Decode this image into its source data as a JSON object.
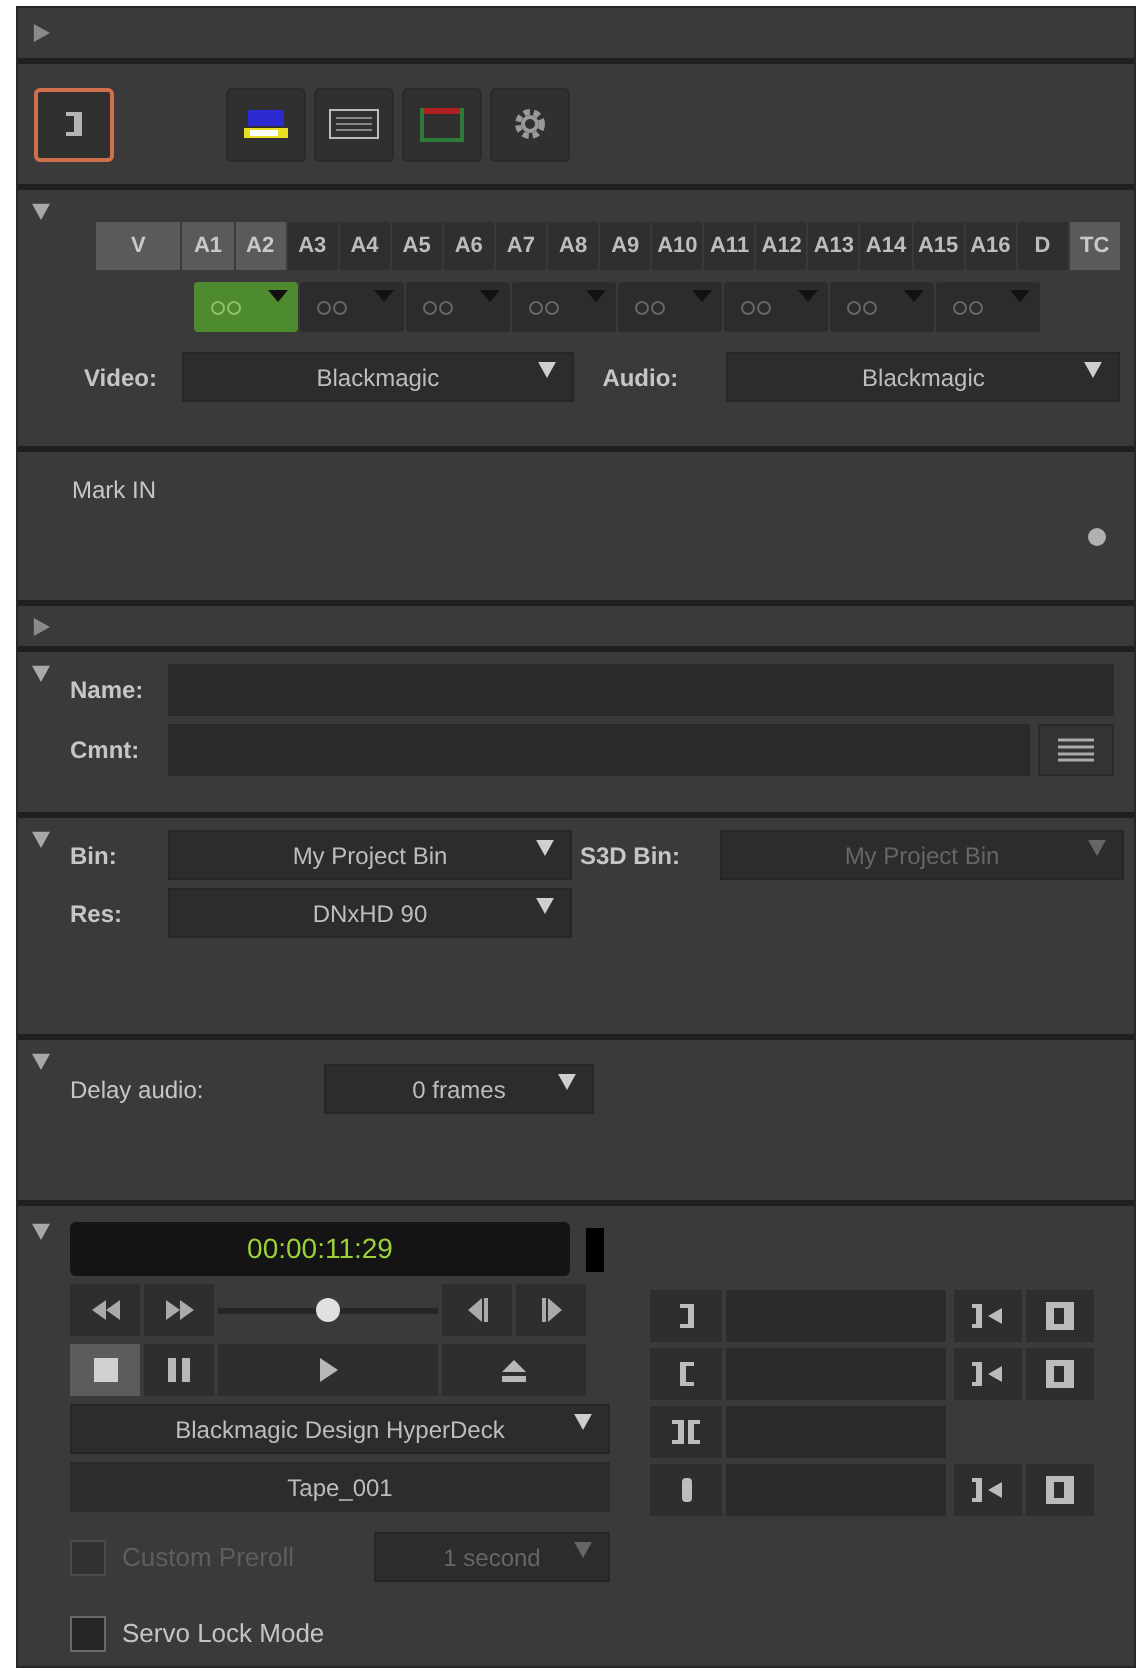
{
  "header": {
    "expanded": false
  },
  "toolbar": {
    "buttons": [
      {
        "kind": "mark",
        "selected": true
      },
      {
        "kind": "bars",
        "selected": false
      },
      {
        "kind": "card",
        "selected": false
      },
      {
        "kind": "frame",
        "selected": false
      },
      {
        "kind": "gear",
        "selected": false
      }
    ]
  },
  "tracks": {
    "expanded": true,
    "buttons": [
      {
        "label": "V",
        "selected": true
      },
      {
        "label": "A1",
        "selected": true
      },
      {
        "label": "A2",
        "selected": true
      },
      {
        "label": "A3",
        "selected": false
      },
      {
        "label": "A4",
        "selected": false
      },
      {
        "label": "A5",
        "selected": false
      },
      {
        "label": "A6",
        "selected": false
      },
      {
        "label": "A7",
        "selected": false
      },
      {
        "label": "A8",
        "selected": false
      },
      {
        "label": "A9",
        "selected": false
      },
      {
        "label": "A10",
        "selected": false
      },
      {
        "label": "A11",
        "selected": false
      },
      {
        "label": "A12",
        "selected": false
      },
      {
        "label": "A13",
        "selected": false
      },
      {
        "label": "A14",
        "selected": false
      },
      {
        "label": "A15",
        "selected": false
      },
      {
        "label": "A16",
        "selected": false
      },
      {
        "label": "D",
        "selected": false
      },
      {
        "label": "TC",
        "selected": true
      }
    ],
    "monitors": [
      {
        "on": true
      },
      {
        "on": false
      },
      {
        "on": false
      },
      {
        "on": false
      },
      {
        "on": false
      },
      {
        "on": false
      },
      {
        "on": false
      },
      {
        "on": false
      }
    ],
    "video": {
      "label": "Video:",
      "value": "Blackmagic"
    },
    "audio": {
      "label": "Audio:",
      "value": "Blackmagic"
    }
  },
  "mark": {
    "label": "Mark IN"
  },
  "collapsed_section": {
    "expanded": false
  },
  "clip": {
    "expanded": true,
    "name_label": "Name:",
    "comment_label": "Cmnt:"
  },
  "bin": {
    "expanded": true,
    "bin_label": "Bin:",
    "bin": "My Project Bin",
    "s3d_label": "S3D Bin:",
    "s3d_bin": "My Project Bin",
    "s3d_disabled": true,
    "res_label": "Res:",
    "res": "DNxHD 90"
  },
  "delay": {
    "expanded": true,
    "label": "Delay audio:",
    "value": "0 frames"
  },
  "deck": {
    "expanded": true,
    "timecode": "00:00:11:29",
    "shuttle": {
      "level": 0.5
    },
    "transport": [
      {
        "kind": "stop",
        "selected": true
      },
      {
        "kind": "pause",
        "selected": false
      },
      {
        "kind": "play",
        "selected": false
      },
      {
        "kind": "eject",
        "selected": false
      }
    ],
    "device": "Blackmagic Design HyperDeck",
    "tape": "Tape_001",
    "preroll": {
      "label": "Custom Preroll",
      "checked": false,
      "disabled": true,
      "value": "1 second"
    },
    "servo": {
      "label": "Servo Lock Mode",
      "checked": false,
      "disabled": false
    },
    "marks": [
      {
        "kind": "out"
      },
      {
        "kind": "in"
      },
      {
        "kind": "duration"
      },
      {
        "kind": "position"
      }
    ]
  }
}
